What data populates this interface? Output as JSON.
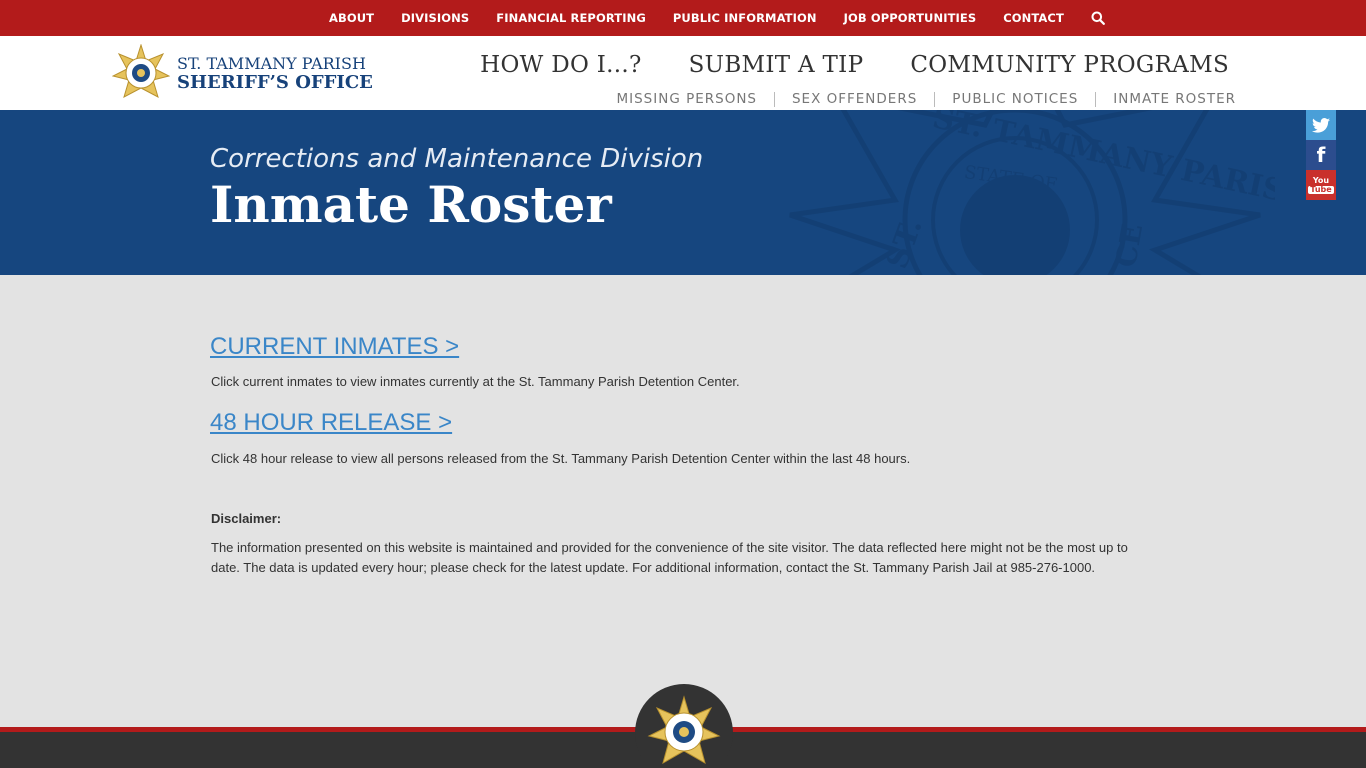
{
  "topnav": {
    "items": [
      "ABOUT",
      "DIVISIONS",
      "FINANCIAL REPORTING",
      "PUBLIC INFORMATION",
      "JOB OPPORTUNITIES",
      "CONTACT"
    ]
  },
  "brand": {
    "line1": "ST. TAMMANY PARISH",
    "line2": "SHERIFF’S OFFICE"
  },
  "mainnav": {
    "items": [
      "HOW DO I...?",
      "SUBMIT A TIP",
      "COMMUNITY PROGRAMS"
    ]
  },
  "subnav": {
    "items": [
      "MISSING PERSONS",
      "SEX OFFENDERS",
      "PUBLIC NOTICES",
      "INMATE ROSTER"
    ]
  },
  "banner": {
    "subtitle": "Corrections and Maintenance Division",
    "title": "Inmate Roster",
    "seal_text": "ST. TAMMANY PARISH",
    "seal_inner": "STATE OF",
    "seal_bottom": "ST.",
    "seal_right": "CE"
  },
  "social": {
    "youtube_top": "You",
    "youtube_bottom": "Tube",
    "facebook": "f"
  },
  "content": {
    "current_link": "CURRENT INMATES >",
    "current_desc": "Click current inmates to view inmates currently at the St. Tammany Parish Detention Center.",
    "release_link": "48 HOUR RELEASE >",
    "release_desc": "Click 48 hour release to view all persons released from the St. Tammany Parish Detention Center within the last 48 hours.",
    "disclaimer_heading": "Disclaimer:",
    "disclaimer_text": "The information presented on this website is maintained and provided for the convenience of the site visitor. The data reflected here might not be the most up to date. The data is updated every hour; please check for the latest update. For additional information, contact the St. Tammany Parish Jail at 985-276-1000."
  },
  "colors": {
    "topbar": "#b31b1b",
    "banner": "#16467f",
    "brand": "#17427a",
    "link": "#3a86c8",
    "footer": "#333333"
  }
}
